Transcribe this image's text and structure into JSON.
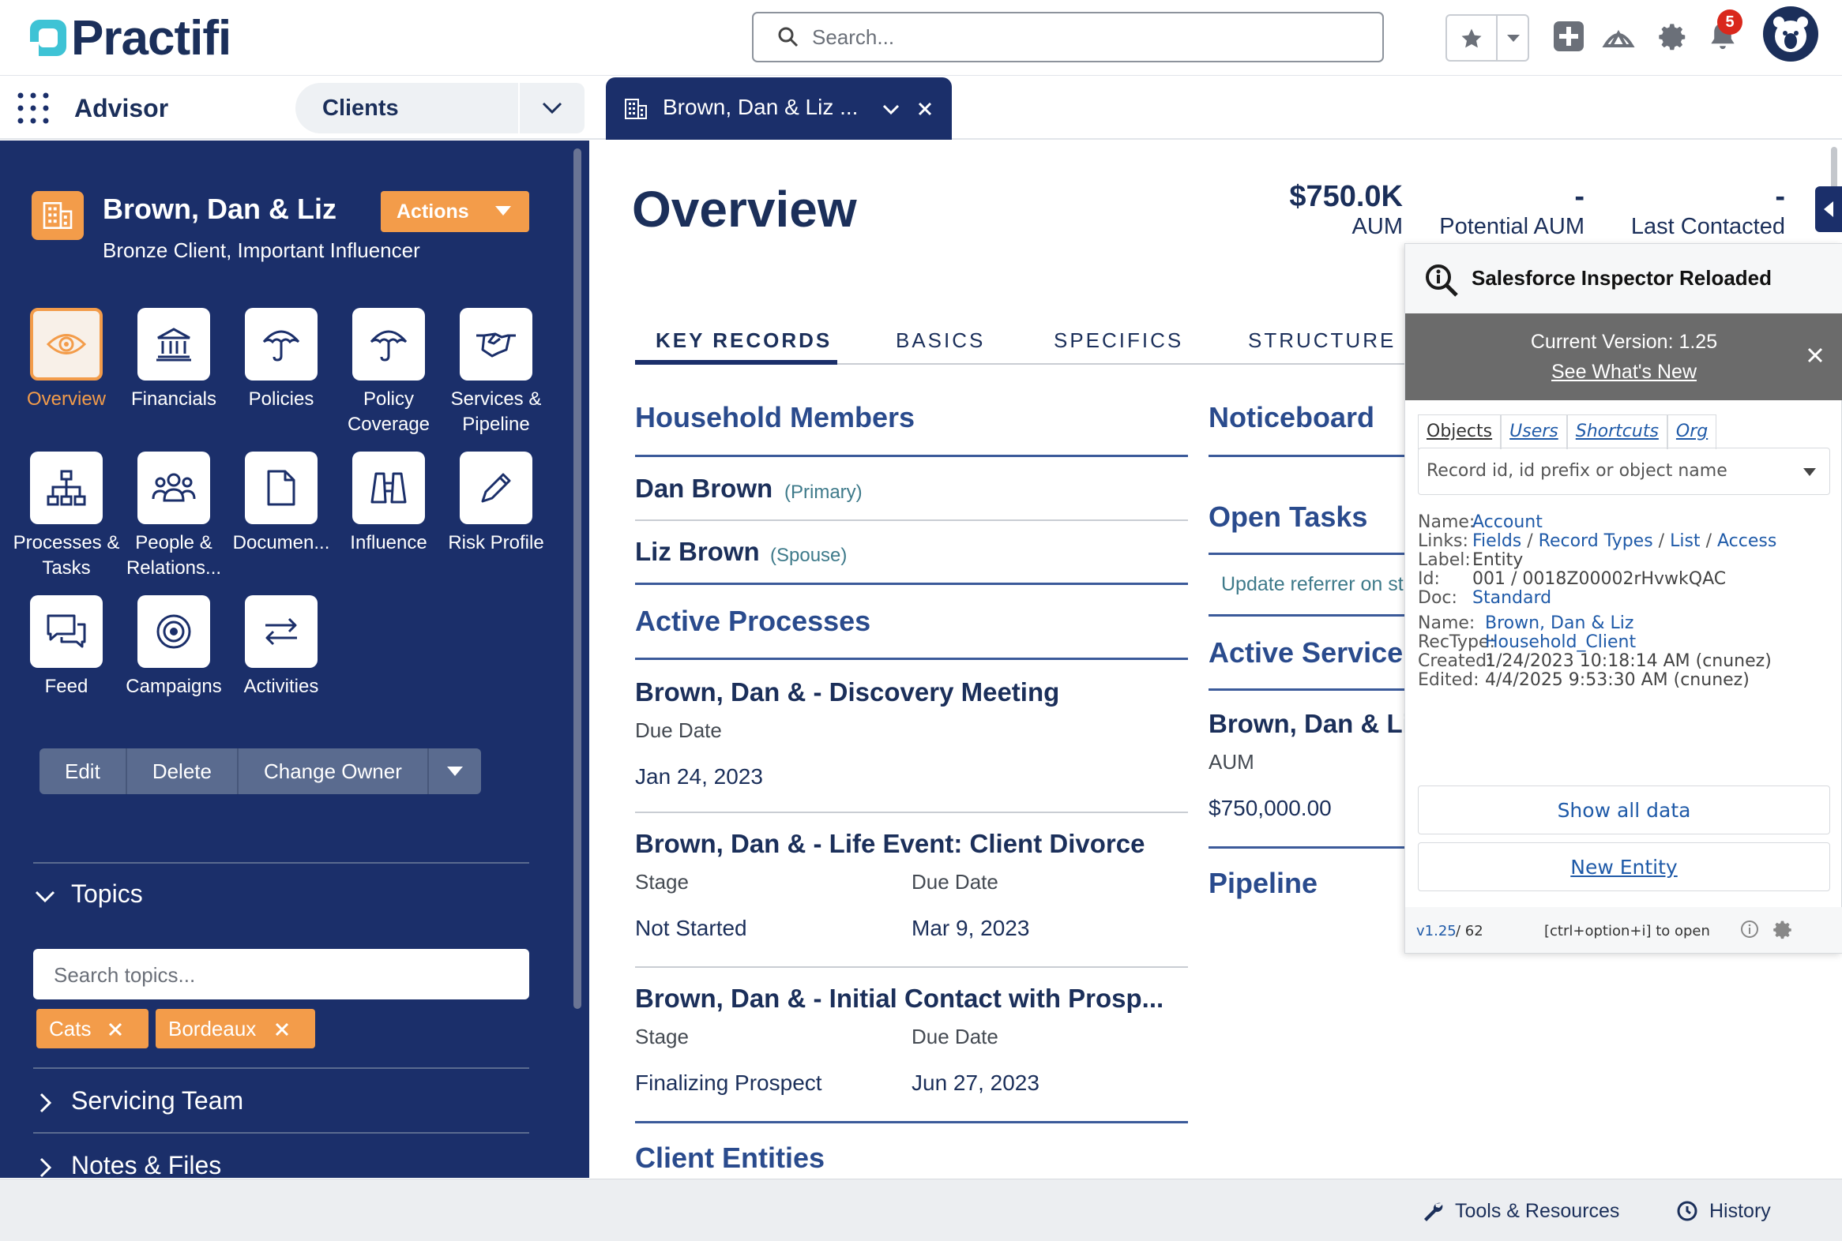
{
  "header": {
    "logo_text": "Practifi",
    "search_placeholder": "Search...",
    "notifications_count": "5"
  },
  "nav": {
    "app_name": "Advisor",
    "object_selector": "Clients",
    "open_tab": "Brown, Dan & Liz ..."
  },
  "sidebar": {
    "record_name": "Brown, Dan & Liz",
    "record_subtitle": "Bronze Client, Important Influencer",
    "actions_label": "Actions",
    "tiles": [
      {
        "label": "Overview",
        "icon": "eye-icon"
      },
      {
        "label": "Financials",
        "icon": "bank-icon"
      },
      {
        "label": "Policies",
        "icon": "umbrella-icon"
      },
      {
        "label": "Policy Coverage",
        "icon": "umbrella-icon"
      },
      {
        "label": "Services & Pipeline",
        "icon": "handshake-icon"
      },
      {
        "label": "Processes & Tasks",
        "icon": "hierarchy-icon"
      },
      {
        "label": "People & Relations...",
        "icon": "people-icon"
      },
      {
        "label": "Documen...",
        "icon": "document-icon"
      },
      {
        "label": "Influence",
        "icon": "binoculars-icon"
      },
      {
        "label": "Risk Profile",
        "icon": "pencil-icon"
      },
      {
        "label": "Feed",
        "icon": "chat-icon"
      },
      {
        "label": "Campaigns",
        "icon": "target-icon"
      },
      {
        "label": "Activities",
        "icon": "arrows-icon"
      }
    ],
    "buttons": {
      "edit": "Edit",
      "delete": "Delete",
      "change_owner": "Change Owner"
    },
    "topics_label": "Topics",
    "topics_placeholder": "Search topics...",
    "topic_chips": [
      "Cats",
      "Bordeaux"
    ],
    "servicing_team_label": "Servicing Team",
    "notes_files_label": "Notes & Files"
  },
  "main": {
    "title": "Overview",
    "kpis": [
      {
        "value": "$750.0K",
        "label": "AUM"
      },
      {
        "value": "-",
        "label": "Potential AUM"
      },
      {
        "value": "-",
        "label": "Last Contacted"
      }
    ],
    "tabs": [
      "KEY RECORDS",
      "BASICS",
      "SPECIFICS",
      "STRUCTURE"
    ],
    "household_title": "Household Members",
    "members": [
      {
        "name": "Dan Brown",
        "role": "(Primary)"
      },
      {
        "name": "Liz Brown",
        "role": "(Spouse)"
      }
    ],
    "active_processes_title": "Active Processes",
    "processes": [
      {
        "title": "Brown, Dan & - Discovery Meeting",
        "fields": [
          {
            "label": "Due Date",
            "value": "Jan 24, 2023"
          }
        ]
      },
      {
        "title": "Brown, Dan & - Life Event: Client Divorce",
        "fields": [
          {
            "label": "Stage",
            "value": "Not Started"
          },
          {
            "label": "Due Date",
            "value": "Mar 9, 2023"
          }
        ]
      },
      {
        "title": "Brown, Dan & - Initial Contact with Prosp...",
        "fields": [
          {
            "label": "Stage",
            "value": "Finalizing Prospect"
          },
          {
            "label": "Due Date",
            "value": "Jun 27, 2023"
          }
        ]
      }
    ],
    "client_entities_title": "Client Entities",
    "noticeboard_title": "Noticeboard",
    "open_tasks_title": "Open Tasks",
    "open_task_text": "Update referrer on st",
    "active_services_title": "Active Service",
    "service_name": "Brown, Dan & Li",
    "service_aum_label": "AUM",
    "service_aum_value": "$750,000.00",
    "pipeline_title": "Pipeline"
  },
  "inspector": {
    "title": "Salesforce Inspector Reloaded",
    "version_text": "Current Version: 1.25",
    "whats_new": "See What's New",
    "tabs": [
      "Objects",
      "Users",
      "Shortcuts",
      "Org"
    ],
    "combo_placeholder": "Record id, id prefix or object name",
    "name_label": "Name:",
    "name_value": "Account",
    "links_label": "Links:",
    "links": [
      "Fields",
      "Record Types",
      "List",
      "Access"
    ],
    "label_label": "Label:",
    "label_value": "Entity",
    "id_label": "Id:",
    "id_value": "001 / 0018Z00002rHvwkQAC",
    "doc_label": "Doc:",
    "doc_value": "Standard",
    "rec_name_label": "Name:",
    "rec_name_value": "Brown, Dan & Liz",
    "rectype_label": "RecType:",
    "rectype_value": "Household_Client",
    "created_label": "Created:",
    "created_value": "1/24/2023 10:18:14 AM (cnunez)",
    "edited_label": "Edited:",
    "edited_value": "4/4/2025 9:53:30 AM (cnunez)",
    "show_all": "Show all data",
    "new_entity": "New Entity",
    "footer_version": "v1.25",
    "footer_count": "/  62",
    "footer_shortcut": "[ctrl+option+i] to open"
  },
  "bottombar": {
    "tools": "Tools & Resources",
    "history": "History"
  },
  "colors": {
    "navy": "#1b2f6a",
    "orange": "#f39c4a",
    "link": "#1f5aa8",
    "badge": "#d9281c"
  }
}
